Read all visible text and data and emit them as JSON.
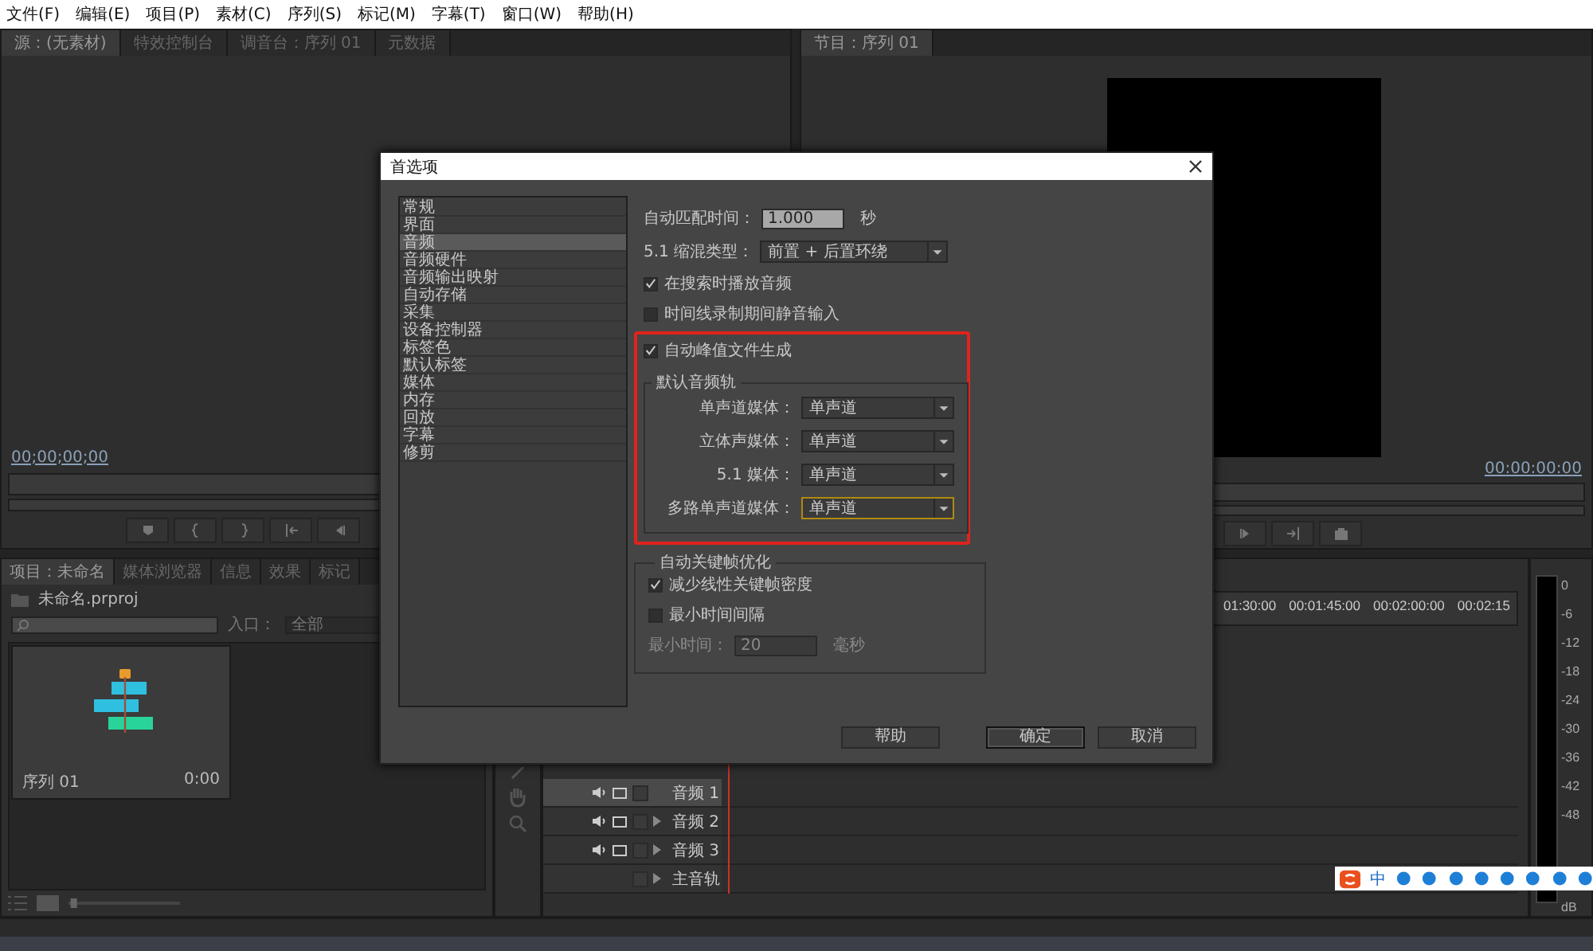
{
  "menu": [
    "文件(F)",
    "编辑(E)",
    "项目(P)",
    "素材(C)",
    "序列(S)",
    "标记(M)",
    "字幕(T)",
    "窗口(W)",
    "帮助(H)"
  ],
  "source_panel": {
    "tabs": [
      {
        "label": "源：(无素材)",
        "selected": true
      },
      {
        "label": "特效控制台",
        "selected": false
      },
      {
        "label": "调音台：序列 01",
        "selected": false
      },
      {
        "label": "元数据",
        "selected": false
      }
    ],
    "timecode": "00;00;00;00"
  },
  "program_panel": {
    "tabs": [
      {
        "label": "节目：序列 01",
        "selected": true
      }
    ],
    "timecode": "00:00:00:00"
  },
  "project_panel": {
    "tabs": [
      {
        "label": "项目：未命名",
        "selected": true
      },
      {
        "label": "媒体浏览器",
        "selected": false
      },
      {
        "label": "信息",
        "selected": false
      },
      {
        "label": "效果",
        "selected": false
      },
      {
        "label": "标记",
        "selected": false
      }
    ],
    "file": "未命名.prproj",
    "in_label": "入口：",
    "in_value": "全部",
    "zoom": {
      "level": 0.02
    },
    "sequence": {
      "name": "序列 01",
      "duration": "0:00"
    }
  },
  "timeline": {
    "ruler": [
      "01:30:00",
      "00:01:45:00",
      "00:02:00:00",
      "00:02:15"
    ],
    "tracks": [
      {
        "name": "音频 1",
        "selected": true,
        "expander": false
      },
      {
        "name": "音频 2",
        "selected": false,
        "expander": true
      },
      {
        "name": "音频 3",
        "selected": false,
        "expander": true
      },
      {
        "name": "主音轨",
        "selected": false,
        "expander": true
      }
    ]
  },
  "meter": {
    "scale": [
      "0",
      "-6",
      "-12",
      "-18",
      "-24",
      "-30",
      "-36",
      "-42",
      "-48"
    ],
    "unit": "dB"
  },
  "dialog": {
    "title": "首选项",
    "categories": [
      {
        "label": "常规",
        "selected": false
      },
      {
        "label": "界面",
        "selected": false
      },
      {
        "label": "音频",
        "selected": true
      },
      {
        "label": "音频硬件",
        "selected": false
      },
      {
        "label": "音频输出映射",
        "selected": false
      },
      {
        "label": "自动存储",
        "selected": false
      },
      {
        "label": "采集",
        "selected": false
      },
      {
        "label": "设备控制器",
        "selected": false
      },
      {
        "label": "标签色",
        "selected": false
      },
      {
        "label": "默认标签",
        "selected": false
      },
      {
        "label": "媒体",
        "selected": false
      },
      {
        "label": "内存",
        "selected": false
      },
      {
        "label": "回放",
        "selected": false
      },
      {
        "label": "字幕",
        "selected": false
      },
      {
        "label": "修剪",
        "selected": false
      }
    ],
    "match_time": {
      "label": "自动匹配时间：",
      "value": "1.000",
      "unit": "秒"
    },
    "downmix": {
      "label": "5.1 缩混类型：",
      "value": "前置 + 后置环绕"
    },
    "options": [
      {
        "label": "在搜索时播放音频",
        "checked": true
      },
      {
        "label": "时间线录制期间静音输入",
        "checked": false
      }
    ],
    "peak_files": {
      "label": "自动峰值文件生成",
      "checked": true
    },
    "default_tracks": {
      "title": "默认音频轨",
      "rows": [
        {
          "label": "单声道媒体：",
          "value": "单声道",
          "focused": false
        },
        {
          "label": "立体声媒体：",
          "value": "单声道",
          "focused": false
        },
        {
          "label": "5.1 媒体：",
          "value": "单声道",
          "focused": false
        },
        {
          "label": "多路单声道媒体：",
          "value": "单声道",
          "focused": true
        }
      ]
    },
    "keyframes": {
      "title": "自动关键帧优化",
      "options": [
        {
          "label": "减少线性关键帧密度",
          "checked": true
        },
        {
          "label": "最小时间间隔",
          "checked": false
        }
      ],
      "min_time": {
        "label": "最小时间：",
        "value": "20",
        "unit": "毫秒",
        "disabled": true
      }
    },
    "buttons": [
      {
        "label": "帮助",
        "default": false
      },
      {
        "label": "确定",
        "default": true
      },
      {
        "label": "取消",
        "default": false
      }
    ]
  },
  "ime_bar": {
    "mode": "中"
  }
}
